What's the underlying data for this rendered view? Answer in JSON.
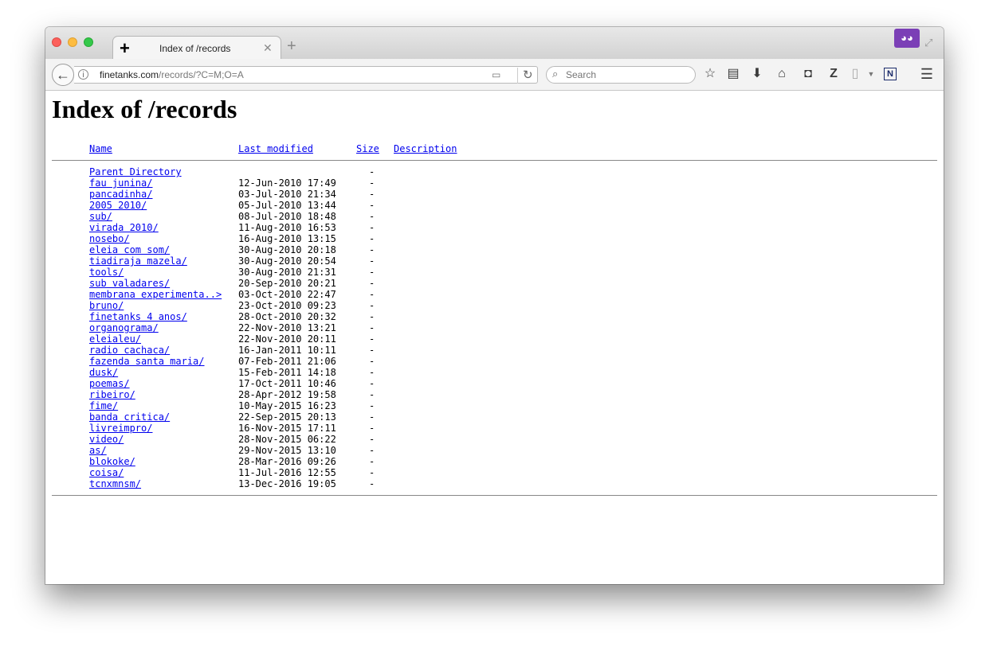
{
  "browser": {
    "tab": {
      "title": "Index of /records"
    },
    "url": {
      "host": "finetanks.com",
      "path": "/records/?C=M;O=A"
    },
    "search": {
      "placeholder": "Search"
    }
  },
  "page": {
    "heading": "Index of /records",
    "columns": {
      "name": "Name",
      "modified": "Last modified",
      "size": "Size",
      "description": "Description"
    },
    "parent": {
      "name": "Parent Directory",
      "size": "-"
    },
    "entries": [
      {
        "name": "fau junina/",
        "modified": "12-Jun-2010 17:49",
        "size": "-"
      },
      {
        "name": "pancadinha/",
        "modified": "03-Jul-2010 21:34",
        "size": "-"
      },
      {
        "name": "2005 2010/",
        "modified": "05-Jul-2010 13:44",
        "size": "-"
      },
      {
        "name": "sub/",
        "modified": "08-Jul-2010 18:48",
        "size": "-"
      },
      {
        "name": "virada 2010/",
        "modified": "11-Aug-2010 16:53",
        "size": "-"
      },
      {
        "name": "nosebo/",
        "modified": "16-Aug-2010 13:15",
        "size": "-"
      },
      {
        "name": "eleia com som/",
        "modified": "30-Aug-2010 20:18",
        "size": "-"
      },
      {
        "name": "tiadiraja mazela/",
        "modified": "30-Aug-2010 20:54",
        "size": "-"
      },
      {
        "name": "tools/",
        "modified": "30-Aug-2010 21:31",
        "size": "-"
      },
      {
        "name": "sub valadares/",
        "modified": "20-Sep-2010 20:21",
        "size": "-"
      },
      {
        "name": "membrana experimenta..>",
        "modified": "03-Oct-2010 22:47",
        "size": "-"
      },
      {
        "name": "bruno/",
        "modified": "23-Oct-2010 09:23",
        "size": "-"
      },
      {
        "name": "finetanks 4 anos/",
        "modified": "28-Oct-2010 20:32",
        "size": "-"
      },
      {
        "name": "organograma/",
        "modified": "22-Nov-2010 13:21",
        "size": "-"
      },
      {
        "name": "eleialeu/",
        "modified": "22-Nov-2010 20:11",
        "size": "-"
      },
      {
        "name": "radio cachaca/",
        "modified": "16-Jan-2011 10:11",
        "size": "-"
      },
      {
        "name": "fazenda santa maria/",
        "modified": "07-Feb-2011 21:06",
        "size": "-"
      },
      {
        "name": "dusk/",
        "modified": "15-Feb-2011 14:18",
        "size": "-"
      },
      {
        "name": "poemas/",
        "modified": "17-Oct-2011 10:46",
        "size": "-"
      },
      {
        "name": "ribeiro/",
        "modified": "28-Apr-2012 19:58",
        "size": "-"
      },
      {
        "name": "fime/",
        "modified": "10-May-2015 16:23",
        "size": "-"
      },
      {
        "name": "banda critica/",
        "modified": "22-Sep-2015 20:13",
        "size": "-"
      },
      {
        "name": "livreimpro/",
        "modified": "16-Nov-2015 17:11",
        "size": "-"
      },
      {
        "name": "video/",
        "modified": "28-Nov-2015 06:22",
        "size": "-"
      },
      {
        "name": "as/",
        "modified": "29-Nov-2015 13:10",
        "size": "-"
      },
      {
        "name": "blokoke/",
        "modified": "28-Mar-2016 09:26",
        "size": "-"
      },
      {
        "name": "coisa/",
        "modified": "11-Jul-2016 12:55",
        "size": "-"
      },
      {
        "name": "tcnxmnsm/",
        "modified": "13-Dec-2016 19:05",
        "size": "-"
      }
    ]
  }
}
